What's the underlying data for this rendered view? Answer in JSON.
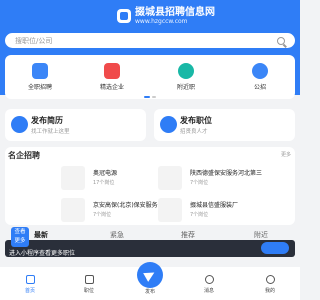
{
  "header": {
    "site_name": "掇城县招聘信息网",
    "site_domain": "www.hzgccw.com"
  },
  "search": {
    "placeholder": "搜职位/公司"
  },
  "quick": [
    {
      "label": "全职招聘",
      "icon": "briefcase-icon",
      "color": "#3b86f7"
    },
    {
      "label": "精选企业",
      "icon": "building-icon",
      "color": "#f04b4b"
    },
    {
      "label": "附近职",
      "icon": "clock-icon",
      "color": "#19b8a6"
    },
    {
      "label": "公招",
      "icon": "people-icon",
      "color": "#3b86f7"
    }
  ],
  "cards": {
    "resume": {
      "title": "发布简历",
      "subtitle": "找工作就上这里"
    },
    "job": {
      "title": "发布职位",
      "subtitle": "招贤良人才"
    }
  },
  "companies": {
    "title": "名企招聘",
    "more": "更多",
    "items": [
      {
        "name": "奥冠电源",
        "count": "17个岗位"
      },
      {
        "name": "陕西德盛保安服务河北第三",
        "count": "7个岗位"
      },
      {
        "name": "京安高保(北京)保安服务",
        "count": "7个岗位"
      },
      {
        "name": "掇城县信盛服装厂",
        "count": "7个岗位"
      }
    ]
  },
  "tabs": [
    "最新",
    "紧急",
    "推荐",
    "附近"
  ],
  "banner": {
    "badge_line1": "查看",
    "badge_line2": "更多",
    "text": "进入小程序查看更多职位"
  },
  "nav": {
    "home": "首页",
    "jobs": "职位",
    "post": "发布",
    "message": "消息",
    "me": "我的"
  }
}
